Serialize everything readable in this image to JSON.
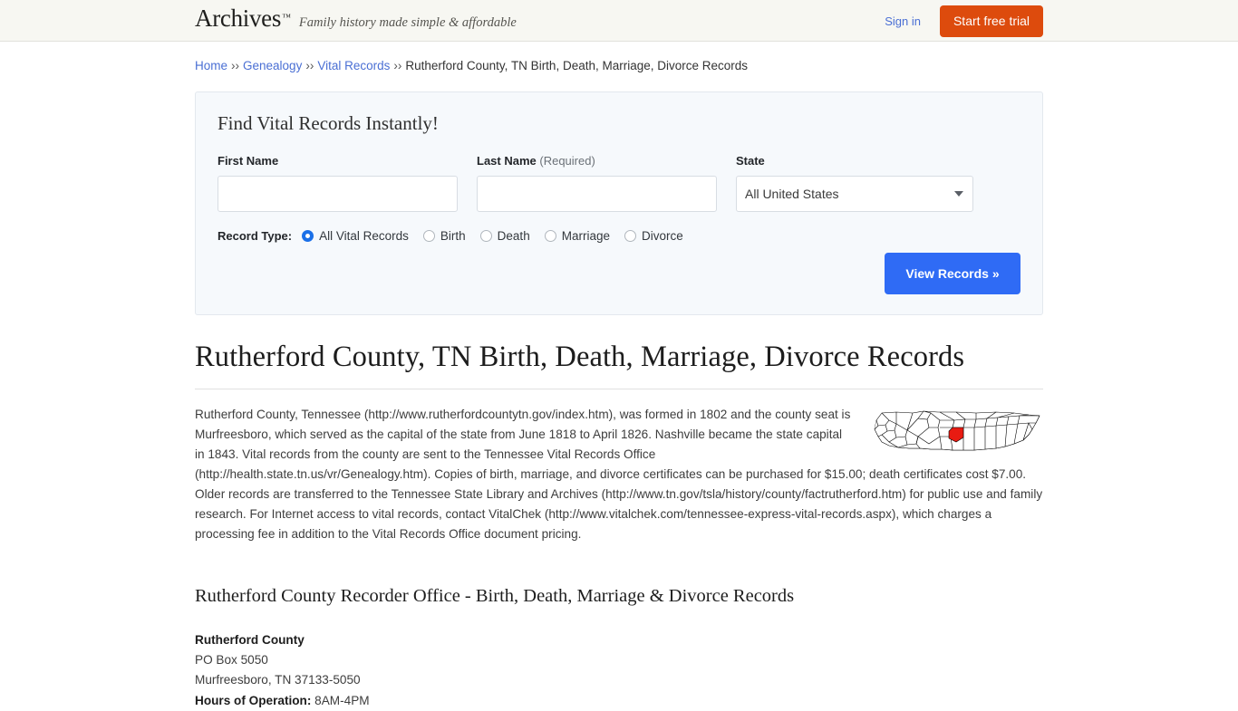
{
  "header": {
    "logo": "Archives",
    "logo_tm": "™",
    "tagline": "Family history made simple & affordable",
    "signin": "Sign in",
    "trial_button": "Start free trial",
    "trial_color": "#dd4b0d",
    "background": "#f7f7f2"
  },
  "breadcrumb": {
    "items": [
      {
        "label": "Home",
        "link": true
      },
      {
        "label": "Genealogy",
        "link": true
      },
      {
        "label": "Vital Records",
        "link": true
      },
      {
        "label": "Rutherford County, TN Birth, Death, Marriage, Divorce Records",
        "link": false
      }
    ],
    "separator": "››"
  },
  "search_panel": {
    "title": "Find Vital Records Instantly!",
    "first_name": {
      "label": "First Name",
      "value": "",
      "placeholder": ""
    },
    "last_name": {
      "label": "Last Name",
      "required_note": "(Required)",
      "value": "",
      "placeholder": ""
    },
    "state": {
      "label": "State",
      "selected": "All United States"
    },
    "record_type": {
      "label": "Record Type:",
      "options": [
        {
          "label": "All Vital Records",
          "checked": true
        },
        {
          "label": "Birth",
          "checked": false
        },
        {
          "label": "Death",
          "checked": false
        },
        {
          "label": "Marriage",
          "checked": false
        },
        {
          "label": "Divorce",
          "checked": false
        }
      ]
    },
    "submit_button": "View Records »",
    "submit_color": "#2f6bf5",
    "background": "#f6f9fc"
  },
  "main": {
    "title": "Rutherford County, TN Birth, Death, Marriage, Divorce Records",
    "paragraph": "Rutherford County, Tennessee (http://www.rutherfordcountytn.gov/index.htm), was formed in 1802 and the county seat is Murfreesboro, which served as the capital of the state from June 1818 to April 1826. Nashville became the state capital in 1843. Vital records from the county are sent to the Tennessee Vital Records Office (http://health.state.tn.us/vr/Genealogy.htm). Copies of birth, marriage, and divorce certificates can be purchased for $15.00; death certificates cost $7.00. Older records are transferred to the Tennessee State Library and Archives (http://www.tn.gov/tsla/history/county/factrutherford.htm) for public use and family research. For Internet access to vital records, contact VitalChek (http://www.vitalchek.com/tennessee-express-vital-records.aspx), which charges a processing fee in addition to the Vital Records Office document pricing.",
    "map_alt": "Map of Tennessee with Rutherford County highlighted",
    "map_highlight_color": "#e81b12",
    "sub_title": "Rutherford County Recorder Office - Birth, Death, Marriage & Divorce Records",
    "address": {
      "name": "Rutherford County",
      "street": "PO Box 5050",
      "city_state_zip": "Murfreesboro, TN 37133-5050",
      "hours_label": "Hours of Operation:",
      "hours_value": "8AM-4PM"
    }
  }
}
